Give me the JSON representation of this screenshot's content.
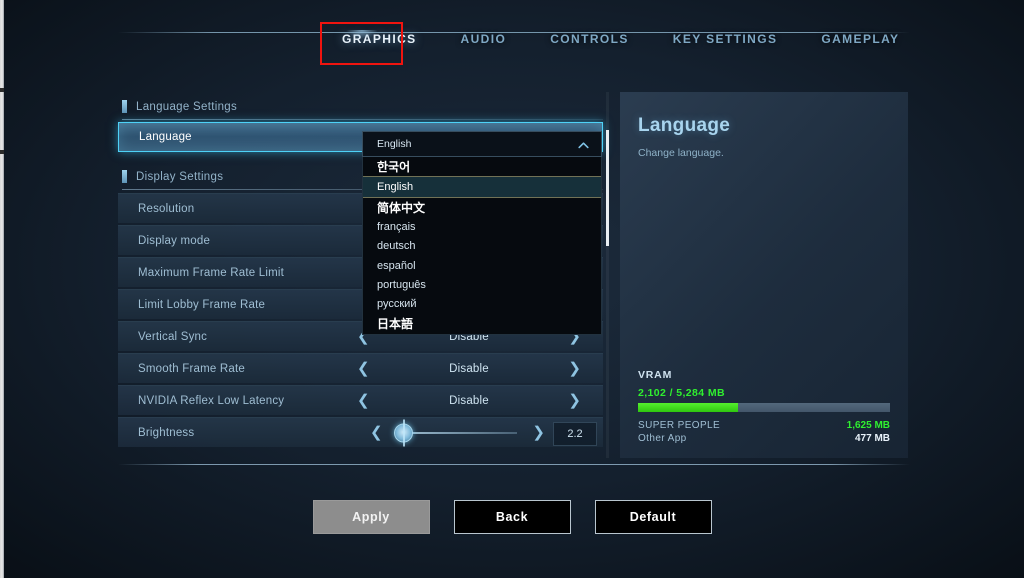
{
  "tabs": [
    {
      "label": "GRAPHICS",
      "active": true
    },
    {
      "label": "AUDIO",
      "active": false
    },
    {
      "label": "CONTROLS",
      "active": false
    },
    {
      "label": "KEY SETTINGS",
      "active": false
    },
    {
      "label": "GAMEPLAY",
      "active": false
    }
  ],
  "sections": {
    "language_settings": "Language Settings",
    "display_settings": "Display Settings"
  },
  "rows": {
    "language": "Language",
    "resolution": "Resolution",
    "display_mode": "Display mode",
    "max_frame_rate_limit": "Maximum Frame Rate Limit",
    "limit_lobby_frame_rate": "Limit Lobby Frame Rate",
    "vertical_sync": "Vertical Sync",
    "smooth_frame_rate": "Smooth Frame Rate",
    "nvidia_reflex": "NVIDIA Reflex Low Latency",
    "brightness": "Brightness"
  },
  "values": {
    "vertical_sync": "Disable",
    "smooth_frame_rate": "Disable",
    "nvidia_reflex": "Disable",
    "brightness": "2.2"
  },
  "dropdown": {
    "current": "English",
    "options": [
      {
        "label": "한국어",
        "cjk": true,
        "selected": false
      },
      {
        "label": "English",
        "cjk": false,
        "selected": true
      },
      {
        "label": "简体中文",
        "cjk": true,
        "selected": false
      },
      {
        "label": "français",
        "cjk": false,
        "selected": false
      },
      {
        "label": "deutsch",
        "cjk": false,
        "selected": false
      },
      {
        "label": "español",
        "cjk": false,
        "selected": false
      },
      {
        "label": "português",
        "cjk": false,
        "selected": false
      },
      {
        "label": "русский",
        "cjk": false,
        "selected": false
      },
      {
        "label": "日本語",
        "cjk": true,
        "selected": false
      }
    ]
  },
  "detail": {
    "title": "Language",
    "description": "Change language.",
    "vram": {
      "title": "VRAM",
      "amount": "2,102 / 5,284 MB",
      "used_percent": 39.8,
      "entries": [
        {
          "name": "SUPER PEOPLE",
          "value": "1,625 MB",
          "color": "green"
        },
        {
          "name": "Other App",
          "value": "477 MB",
          "color": "white"
        }
      ]
    }
  },
  "buttons": [
    {
      "label": "Apply",
      "style": "disabled"
    },
    {
      "label": "Back",
      "style": "normal"
    },
    {
      "label": "Default",
      "style": "normal"
    }
  ],
  "colors": {
    "accent_cyan": "#4ed2f7",
    "highlight_red": "#f0140f",
    "vram_green": "#2ff02f"
  }
}
